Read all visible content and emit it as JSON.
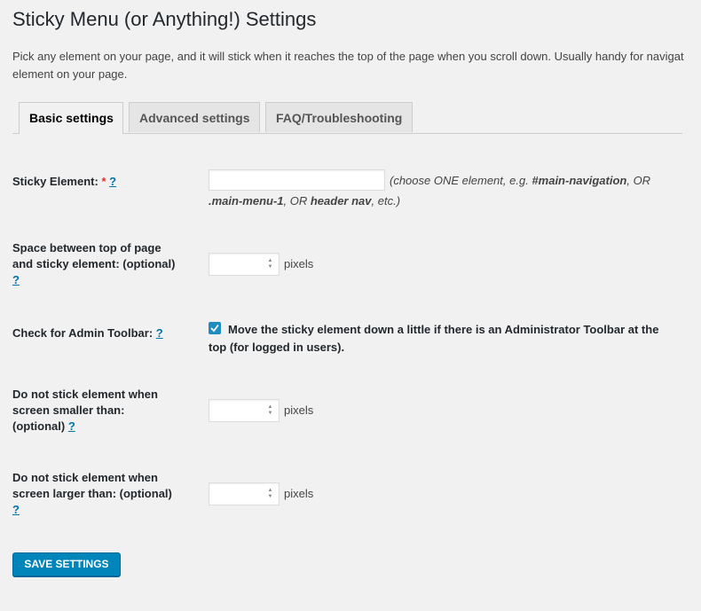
{
  "page": {
    "title": "Sticky Menu (or Anything!) Settings",
    "intro_line1": "Pick any element on your page, and it will stick when it reaches the top of the page when you scroll down. Usually handy for navigat",
    "intro_line2": "element on your page."
  },
  "tabs": [
    {
      "label": "Basic settings",
      "active": true
    },
    {
      "label": "Advanced settings",
      "active": false
    },
    {
      "label": "FAQ/Troubleshooting",
      "active": false
    }
  ],
  "fields": {
    "sticky_element": {
      "label": "Sticky Element:",
      "required_mark": "*",
      "help": "?",
      "value": "",
      "desc_a": "(choose ONE element, e.g. ",
      "desc_b": "#main-navigation",
      "desc_c": ", OR",
      "desc_d": ".main-menu-1",
      "desc_e": ", OR ",
      "desc_f": "header nav",
      "desc_g": ", etc.)"
    },
    "space_top": {
      "label_line1": "Space between top of page",
      "label_line2": "and sticky element: (optional)",
      "help": "?",
      "value": "",
      "unit": "pixels"
    },
    "admin_toolbar": {
      "label": "Check for Admin Toolbar:",
      "help": "?",
      "checked": true,
      "checkbox_label": "Move the sticky element down a little if there is an Administrator Toolbar at the top (for logged in users)."
    },
    "min_screen": {
      "label_line1": "Do not stick element when",
      "label_line2": "screen smaller than:",
      "label_line3": "(optional)",
      "help": "?",
      "value": "",
      "unit": "pixels"
    },
    "max_screen": {
      "label_line1": "Do not stick element when",
      "label_line2": "screen larger than: (optional)",
      "help": "?",
      "value": "",
      "unit": "pixels"
    }
  },
  "actions": {
    "save_label": "SAVE SETTINGS"
  },
  "colors": {
    "accent": "#0085ba",
    "link": "#0073aa",
    "required": "#dc3232",
    "checkbox": "#1e8cbe"
  }
}
